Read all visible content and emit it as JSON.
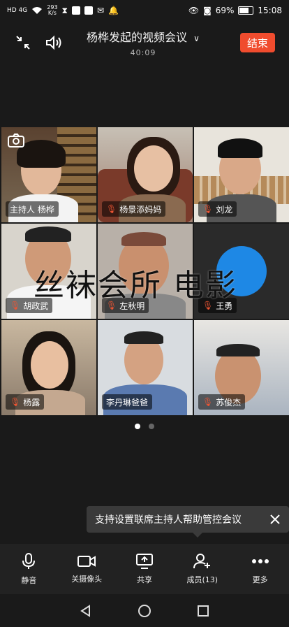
{
  "status_bar": {
    "network": "HD 4G",
    "speed_value": "293",
    "speed_unit": "K/s",
    "battery": "69%",
    "time": "15:08"
  },
  "header": {
    "title": "杨桦发起的视频会议",
    "timer": "40:09",
    "end_label": "结束"
  },
  "participants": [
    {
      "name": "主持人 杨桦",
      "muted": false
    },
    {
      "name": "杨景添妈妈",
      "muted": true
    },
    {
      "name": "刘龙",
      "muted": true
    },
    {
      "name": "胡政武",
      "muted": true
    },
    {
      "name": "左秋明",
      "muted": true
    },
    {
      "name": "王勇",
      "muted": true
    },
    {
      "name": "杨露",
      "muted": true
    },
    {
      "name": "李丹琳爸爸",
      "muted": false
    },
    {
      "name": "苏俊杰",
      "muted": true
    }
  ],
  "watermark": "丝袜会所 电影",
  "tooltip": {
    "text": "支持设置联席主持人帮助管控会议"
  },
  "toolbar": {
    "mute": "静音",
    "camera": "关摄像头",
    "share": "共享",
    "members": "成员(13)",
    "more": "更多"
  },
  "colors": {
    "end_button": "#f04c2e",
    "background": "#1a1a1a",
    "toolbar": "#222222"
  }
}
